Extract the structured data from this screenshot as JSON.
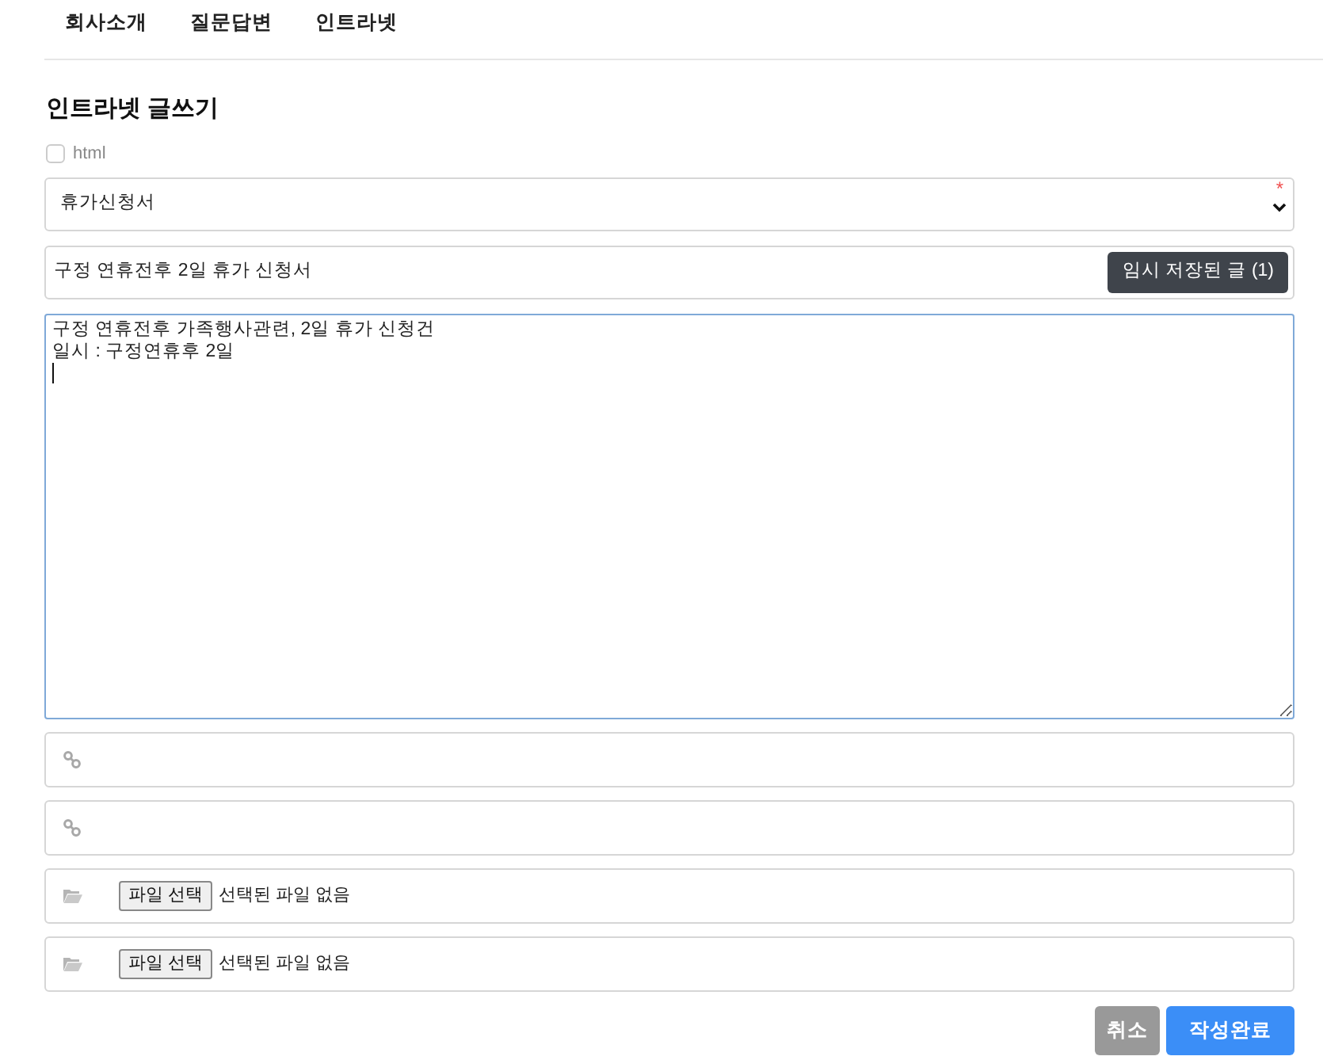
{
  "nav": {
    "items": [
      {
        "label": "회사소개"
      },
      {
        "label": "질문답변"
      },
      {
        "label": "인트라넷"
      }
    ]
  },
  "page_title": "인트라넷 글쓰기",
  "html_option": {
    "label": "html",
    "checked": false
  },
  "category": {
    "value": "휴가신청서",
    "required_mark": "*"
  },
  "subject": {
    "value": "구정 연휴전후 2일 휴가 신청서",
    "draft_button": "임시 저장된 글 (1)"
  },
  "body": {
    "value": "구정 연휴전후 가족행사관련, 2일 휴가 신청건\n일시 : 구정연휴후 2일\n"
  },
  "attachments": [
    {
      "kind": "link"
    },
    {
      "kind": "link"
    },
    {
      "kind": "file",
      "button": "파일 선택",
      "status": "선택된 파일 없음"
    },
    {
      "kind": "file",
      "button": "파일 선택",
      "status": "선택된 파일 없음"
    }
  ],
  "buttons": [
    {
      "kind": "cancel",
      "label": "취소"
    },
    {
      "kind": "submit",
      "label": "작성완료"
    }
  ]
}
